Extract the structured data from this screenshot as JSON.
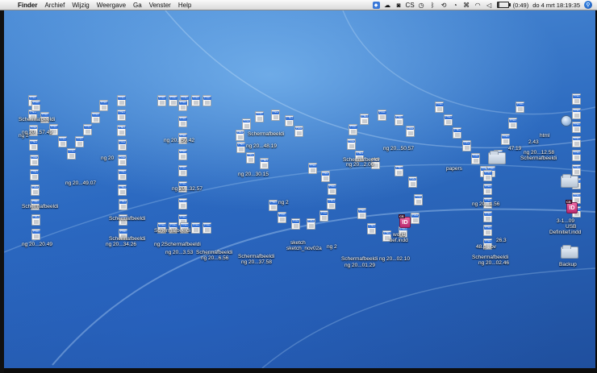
{
  "menubar": {
    "apple_glyph": "",
    "items": [
      "Finder",
      "Archief",
      "Wijzig",
      "Weergave",
      "Ga",
      "Venster",
      "Help"
    ],
    "cs_label": "CS",
    "battery_text": "(0:49)",
    "battery_level": 0.2,
    "datetime": "do 4 mrt  18:19:35"
  },
  "desktop": {
    "file_labels": {
      "l1": "Schermafbeeldi",
      "l2": "ng 20...20.49",
      "l3": "ng 2",
      "l4": "ng 20",
      "l5": "ng 20...34.26",
      "l6": "Schermafbeeldi",
      "l7": "ng 2Schermafbeeldi",
      "l8": "ng 20...48.19",
      "l9": "Schermafbeeldi",
      "l10": "ng 20...50.57",
      "l11": "ng 20...49.07",
      "l12": "ng 20...32.57",
      "l13": "Schermafbeeldi",
      "l14": "ng 20...3.53",
      "l15": "Schermafbeeldi",
      "l16": "ng 20...2.06",
      "l17": "Schermafbeeldi",
      "l18": "ng 20...37.58",
      "l19": "sketch_nov02a",
      "l20": "Schermafbeeldi",
      "l21": "ng 20...01.29",
      "l22": "ng 2",
      "l23": "world",
      "l24": "tief.indd",
      "l25": "ng 20...02.10",
      "l26": "Schermafbeeldi",
      "l27": "ng 20...02.46",
      "l28": "papers",
      "l29": "47.19",
      "l30": "Definitief.indd",
      "l31": "Backup",
      "l32": "html",
      "l33": "Schermafbeeldi",
      "l34": "ng 20...12.58",
      "l35": "2.43",
      "l36": "3-1...09",
      "l37": "USB",
      "l38": "Schermafbeeldi",
      "l39": "ng 20...57.49",
      "l40": "ng 20...50.42",
      "l41": "Schermafbeeldi",
      "l42": "ng 20...30.15",
      "l43": "ng 20...6.56",
      "l44": "ng 2",
      "l45": "Schermafbeeldi",
      "l46": "ng 20...1.56",
      "l47": "26.3",
      "l48": "48.p...ov",
      "l49": "sketch"
    }
  },
  "colors": {
    "wallpaper_top": "#4f8fd8",
    "wallpaper_bottom": "#1f4f9e",
    "png_badge": "#2f6fd6",
    "indesign": "#d43c84"
  }
}
